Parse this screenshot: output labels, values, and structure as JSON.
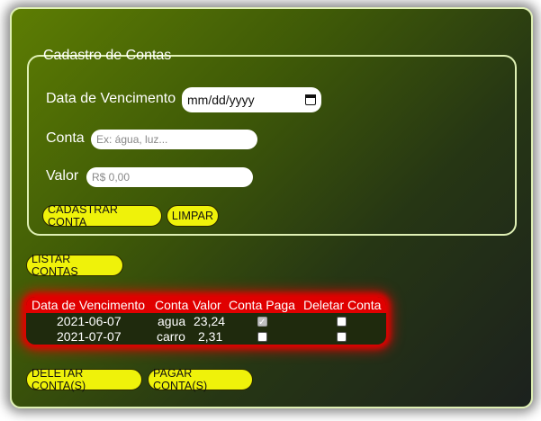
{
  "form": {
    "legend": "Cadastro de Contas",
    "date_label": "Data de Vencimento",
    "date_placeholder": "mm/dd/yyyy",
    "conta_label": "Conta",
    "conta_placeholder": "Ex: água, luz...",
    "valor_label": "Valor",
    "valor_placeholder": "R$ 0,00",
    "cadastrar_button": "CADASTRAR CONTA",
    "limpar_button": "LIMPAR"
  },
  "list_button": "LISTAR CONTAS",
  "table": {
    "headers": [
      "Data de Vencimento",
      "Conta",
      "Valor",
      "Conta Paga",
      "Deletar Conta"
    ],
    "rows": [
      {
        "date": "2021-06-07",
        "conta": "agua",
        "valor": "23,24",
        "paga": true,
        "deletar": false
      },
      {
        "date": "2021-07-07",
        "conta": "carro",
        "valor": "2,31",
        "paga": false,
        "deletar": false
      }
    ]
  },
  "actions": {
    "delete_button": "DELETAR CONTA(S)",
    "pay_button": "PAGAR CONTA(S)"
  },
  "colors": {
    "button": "#eff20a",
    "table_header": "#e00000",
    "border": "#dff0b4"
  }
}
